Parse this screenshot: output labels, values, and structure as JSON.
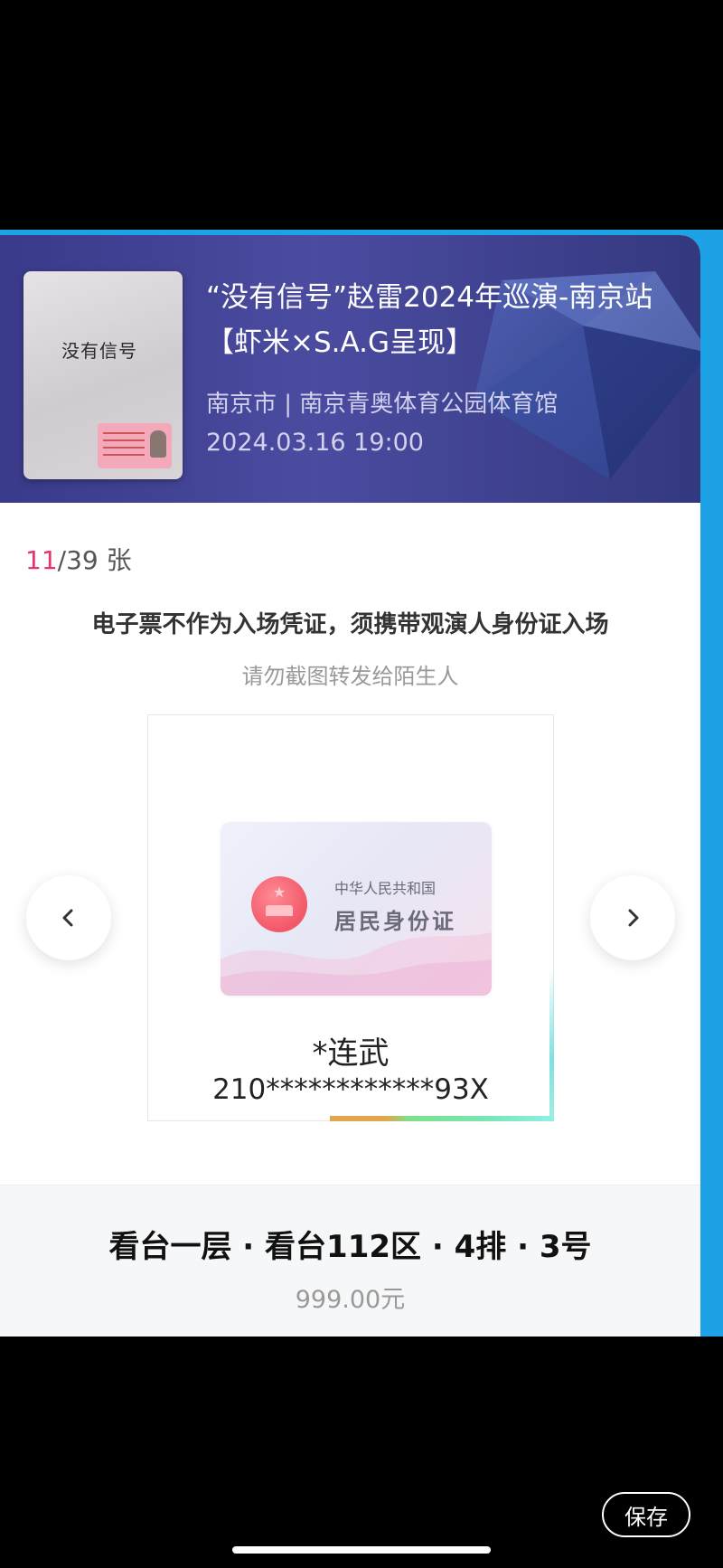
{
  "event": {
    "title": "“没有信号”赵雷2024年巡演-南京站【虾米×S.A.G呈现】",
    "venue": "南京市 | 南京青奥体育公园体育馆",
    "datetime": "2024.03.16 19:00",
    "poster_title": "没有信号"
  },
  "counter": {
    "current": "11",
    "total": "/39 张"
  },
  "notice": {
    "main": "电子票不作为入场凭证，须携带观演人身份证入场",
    "sub": "请勿截图转发给陌生人"
  },
  "id_card": {
    "country": "中华人民共和国",
    "card_name": "居民身份证",
    "holder_name": "*连武",
    "id_number": "210************93X"
  },
  "seat": {
    "location": "看台一层 · 看台112区 · 4排 · 3号",
    "price": "999.00元"
  },
  "actions": {
    "save_label": "保存"
  },
  "icons": {
    "prev": "chevron-left-icon",
    "next": "chevron-right-icon"
  },
  "colors": {
    "accent_pink": "#e8336b",
    "sheet_blue": "#1ea2e6",
    "header_purple": "#3a3a8a"
  }
}
